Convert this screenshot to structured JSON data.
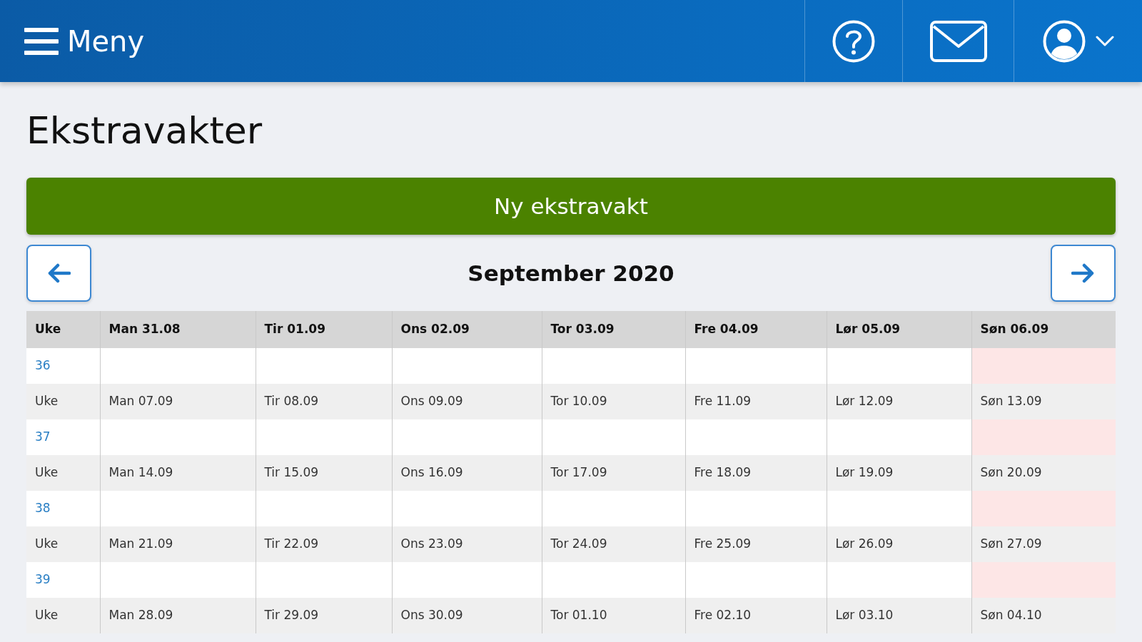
{
  "topbar": {
    "menu_label": "Meny"
  },
  "page_title": "Ekstravakter",
  "new_shift_button": "Ny ekstravakt",
  "calendar": {
    "month": "September 2020",
    "columns": [
      "Uke",
      "Man 31.08",
      "Tir 01.09",
      "Ons 02.09",
      "Tor 03.09",
      "Fre 04.09",
      "Lør 05.09",
      "Søn 06.09"
    ],
    "rows": [
      {
        "kind": "week",
        "week": "36"
      },
      {
        "kind": "days",
        "cells": [
          "Uke",
          "Man 07.09",
          "Tir 08.09",
          "Ons 09.09",
          "Tor 10.09",
          "Fre 11.09",
          "Lør 12.09",
          "Søn 13.09"
        ]
      },
      {
        "kind": "week",
        "week": "37"
      },
      {
        "kind": "days",
        "cells": [
          "Uke",
          "Man 14.09",
          "Tir 15.09",
          "Ons 16.09",
          "Tor 17.09",
          "Fre 18.09",
          "Lør 19.09",
          "Søn 20.09"
        ]
      },
      {
        "kind": "week",
        "week": "38"
      },
      {
        "kind": "days",
        "cells": [
          "Uke",
          "Man 21.09",
          "Tir 22.09",
          "Ons 23.09",
          "Tor 24.09",
          "Fre 25.09",
          "Lør 26.09",
          "Søn 27.09"
        ]
      },
      {
        "kind": "week",
        "week": "39"
      },
      {
        "kind": "days",
        "cells": [
          "Uke",
          "Man 28.09",
          "Tir 29.09",
          "Ons 30.09",
          "Tor 01.10",
          "Fre 02.10",
          "Lør 03.10",
          "Søn 04.10"
        ]
      }
    ]
  }
}
